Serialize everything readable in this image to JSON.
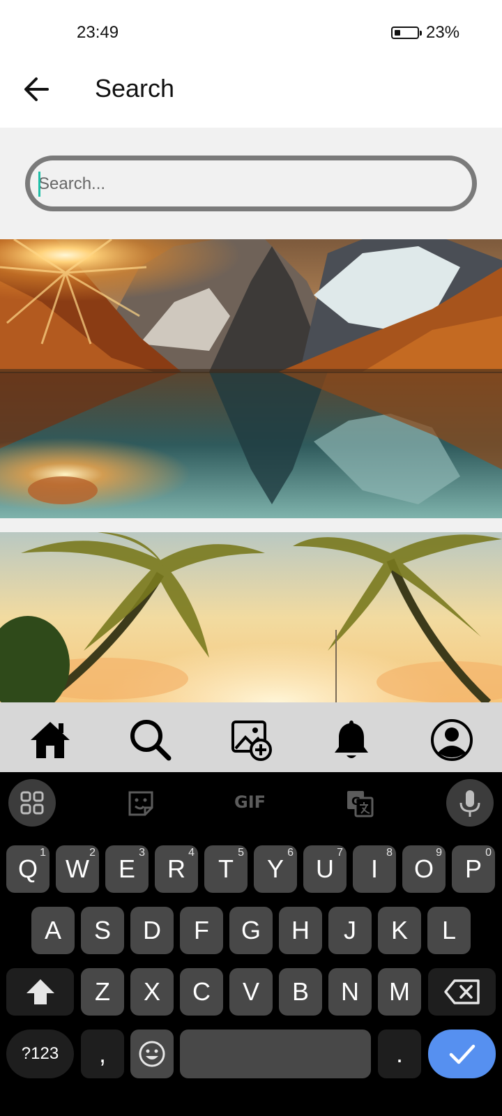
{
  "status_bar": {
    "time": "23:49",
    "battery_percent": "23%",
    "battery_level": 0.23
  },
  "app_bar": {
    "title": "Search",
    "back_icon": "arrow-left-icon"
  },
  "search": {
    "placeholder": "Search...",
    "value": ""
  },
  "results": [
    {
      "icon": "image",
      "description_visible": false
    },
    {
      "icon": "image",
      "description_visible": false
    }
  ],
  "bottom_nav": {
    "items": [
      {
        "icon": "home-icon"
      },
      {
        "icon": "search-icon"
      },
      {
        "icon": "add-photo-icon"
      },
      {
        "icon": "bell-icon"
      },
      {
        "icon": "profile-icon"
      }
    ]
  },
  "keyboard": {
    "toolbar": {
      "gif_label": "GIF",
      "icons": [
        "apps-grid-icon",
        "sticker-icon",
        "gif-icon",
        "translate-icon",
        "mic-icon"
      ]
    },
    "row1": [
      {
        "label": "Q",
        "hint": "1"
      },
      {
        "label": "W",
        "hint": "2"
      },
      {
        "label": "E",
        "hint": "3"
      },
      {
        "label": "R",
        "hint": "4"
      },
      {
        "label": "T",
        "hint": "5"
      },
      {
        "label": "Y",
        "hint": "6"
      },
      {
        "label": "U",
        "hint": "7"
      },
      {
        "label": "I",
        "hint": "8"
      },
      {
        "label": "O",
        "hint": "9"
      },
      {
        "label": "P",
        "hint": "0"
      }
    ],
    "row2": [
      "A",
      "S",
      "D",
      "F",
      "G",
      "H",
      "J",
      "K",
      "L"
    ],
    "row3": [
      "Z",
      "X",
      "C",
      "V",
      "B",
      "N",
      "M"
    ],
    "symbols_label": "?123",
    "comma_label": ",",
    "period_label": "."
  },
  "colors": {
    "accent_caret": "#1fbfa8",
    "done_key": "#5690f0",
    "nav_bg": "#d7d7d7"
  }
}
